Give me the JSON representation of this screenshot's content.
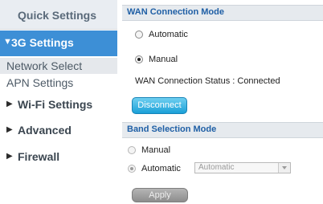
{
  "sidebar": {
    "quick_settings": "Quick Settings",
    "active_section": "3G Settings",
    "sub_items": [
      "Network Select",
      "APN Settings"
    ],
    "items": [
      "Wi-Fi Settings",
      "Advanced",
      "Firewall"
    ]
  },
  "wan_mode": {
    "title": "WAN Connection Mode",
    "options": [
      "Automatic",
      "Manual"
    ],
    "selected": "Manual",
    "status": "WAN Connection Status : Connected",
    "disconnect_label": "Disconnect"
  },
  "band_mode": {
    "title": "Band Selection Mode",
    "options": [
      "Manual",
      "Automatic"
    ],
    "selected": "Automatic",
    "select_value": "Automatic",
    "apply_label": "Apply"
  },
  "colors": {
    "accent": "#3d8fd6",
    "section_title": "#1f5fa5",
    "button": "#1aa0d8"
  }
}
